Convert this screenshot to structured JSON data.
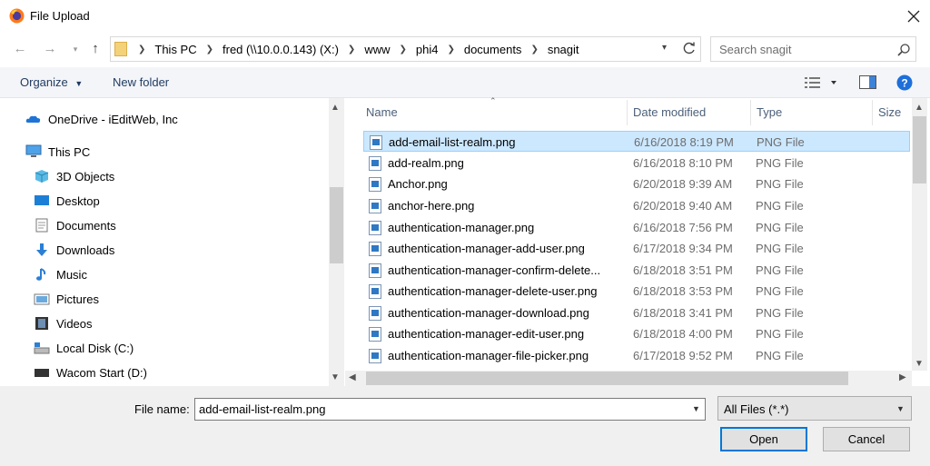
{
  "window": {
    "title": "File Upload"
  },
  "address": {
    "crumbs": [
      "This PC",
      "fred (\\\\10.0.0.143) (X:)",
      "www",
      "phi4",
      "documents",
      "snagit"
    ]
  },
  "search": {
    "placeholder": "Search snagit"
  },
  "toolbar": {
    "organize_label": "Organize",
    "new_folder_label": "New folder"
  },
  "nav": {
    "items": [
      {
        "label": "OneDrive - iEditWeb, Inc",
        "icon": "cloud-icon"
      },
      {
        "label": "This PC",
        "icon": "computer-icon"
      },
      {
        "label": "3D Objects",
        "icon": "cube-icon"
      },
      {
        "label": "Desktop",
        "icon": "desktop-icon"
      },
      {
        "label": "Documents",
        "icon": "documents-icon"
      },
      {
        "label": "Downloads",
        "icon": "download-arrow-icon"
      },
      {
        "label": "Music",
        "icon": "music-note-icon"
      },
      {
        "label": "Pictures",
        "icon": "pictures-icon"
      },
      {
        "label": "Videos",
        "icon": "film-icon"
      },
      {
        "label": "Local Disk (C:)",
        "icon": "drive-icon"
      },
      {
        "label": "Wacom Start (D:)",
        "icon": "drive-dark-icon"
      }
    ]
  },
  "columns": {
    "name": "Name",
    "date": "Date modified",
    "type": "Type",
    "size": "Size"
  },
  "files": [
    {
      "name": "add-email-list-realm.png",
      "date": "6/16/2018 8:19 PM",
      "type": "PNG File"
    },
    {
      "name": "add-realm.png",
      "date": "6/16/2018 8:10 PM",
      "type": "PNG File"
    },
    {
      "name": "Anchor.png",
      "date": "6/20/2018 9:39 AM",
      "type": "PNG File"
    },
    {
      "name": "anchor-here.png",
      "date": "6/20/2018 9:40 AM",
      "type": "PNG File"
    },
    {
      "name": "authentication-manager.png",
      "date": "6/16/2018 7:56 PM",
      "type": "PNG File"
    },
    {
      "name": "authentication-manager-add-user.png",
      "date": "6/17/2018 9:34 PM",
      "type": "PNG File"
    },
    {
      "name": "authentication-manager-confirm-delete...",
      "date": "6/18/2018 3:51 PM",
      "type": "PNG File"
    },
    {
      "name": "authentication-manager-delete-user.png",
      "date": "6/18/2018 3:53 PM",
      "type": "PNG File"
    },
    {
      "name": "authentication-manager-download.png",
      "date": "6/18/2018 3:41 PM",
      "type": "PNG File"
    },
    {
      "name": "authentication-manager-edit-user.png",
      "date": "6/18/2018 4:00 PM",
      "type": "PNG File"
    },
    {
      "name": "authentication-manager-file-picker.png",
      "date": "6/17/2018 9:52 PM",
      "type": "PNG File"
    }
  ],
  "footer": {
    "filename_label": "File name:",
    "filename_value": "add-email-list-realm.png",
    "filter_value": "All Files (*.*)",
    "open_label": "Open",
    "cancel_label": "Cancel"
  },
  "colors": {
    "accent": "#0078d7",
    "selection": "#cce8ff",
    "help": "#1e6fd9"
  }
}
